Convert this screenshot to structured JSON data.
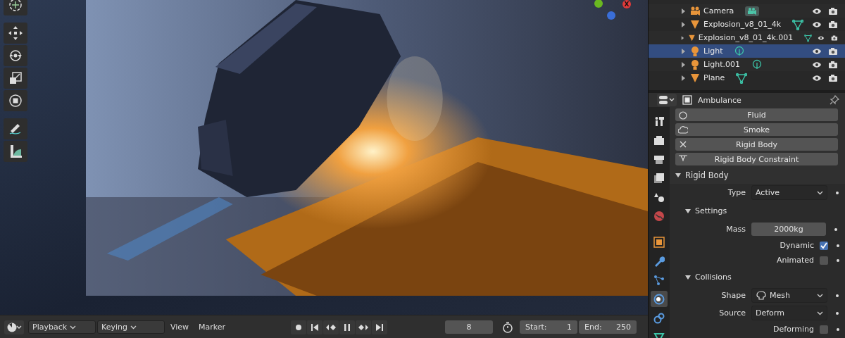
{
  "viewport": {
    "gizmo_x": "X",
    "tools": [
      {
        "kind": "cursor"
      },
      {
        "kind": "move"
      },
      {
        "kind": "rotate"
      },
      {
        "kind": "scale"
      },
      {
        "kind": "transform"
      },
      {
        "kind": "annotate"
      },
      {
        "kind": "measure"
      }
    ]
  },
  "timeline": {
    "menus": [
      {
        "label": "Playback",
        "dropdown": true
      },
      {
        "label": "Keying",
        "dropdown": true
      },
      {
        "label": "View",
        "dropdown": false
      },
      {
        "label": "Marker",
        "dropdown": false
      }
    ],
    "transport": [
      {
        "kind": "record"
      },
      {
        "kind": "jump-start"
      },
      {
        "kind": "prev-key"
      },
      {
        "kind": "pause"
      },
      {
        "kind": "next-key"
      },
      {
        "kind": "jump-end"
      }
    ],
    "current_frame": "8",
    "start_label": "Start:",
    "start": "1",
    "end_label": "End:",
    "end": "250"
  },
  "outliner": {
    "rows": [
      {
        "name": "Camera",
        "kind": "camera",
        "selected": false
      },
      {
        "name": "Explosion_v8_01_4k",
        "kind": "mesh",
        "selected": false
      },
      {
        "name": "Explosion_v8_01_4k.001",
        "kind": "mesh",
        "selected": false
      },
      {
        "name": "Light",
        "kind": "light",
        "selected": true
      },
      {
        "name": "Light.001",
        "kind": "light",
        "selected": false
      },
      {
        "name": "Plane",
        "kind": "mesh",
        "selected": false
      }
    ]
  },
  "properties": {
    "object_name": "Ambulance",
    "tabs": [
      {
        "kind": "tool",
        "selected": false
      },
      {
        "kind": "render",
        "selected": false
      },
      {
        "kind": "output",
        "selected": false
      },
      {
        "kind": "view-layer",
        "selected": false
      },
      {
        "kind": "scene",
        "selected": false
      },
      {
        "kind": "world",
        "selected": false
      },
      {
        "kind": "object",
        "selected": false
      },
      {
        "kind": "modifier",
        "selected": false
      },
      {
        "kind": "particles",
        "selected": false
      },
      {
        "kind": "physics",
        "selected": true
      },
      {
        "kind": "constraint",
        "selected": false
      },
      {
        "kind": "data",
        "selected": false
      }
    ],
    "physics_buttons": [
      {
        "label": "Fluid",
        "kind": "fluid"
      },
      {
        "label": "Smoke",
        "kind": "smoke"
      },
      {
        "label": "Rigid Body",
        "kind": "remove"
      },
      {
        "label": "Rigid Body Constraint",
        "kind": "constraint"
      }
    ],
    "panel": {
      "title": "Rigid Body",
      "expanded": true,
      "rows": [
        {
          "kind": "dropdown",
          "label": "Type",
          "value": "Active"
        },
        {
          "kind": "subpanel",
          "title": "Settings",
          "expanded": true
        },
        {
          "kind": "number",
          "label": "Mass",
          "value": "2000kg"
        },
        {
          "kind": "checkbox",
          "label": "Dynamic",
          "checked": true
        },
        {
          "kind": "checkbox",
          "label": "Animated",
          "checked": false
        },
        {
          "kind": "subpanel",
          "title": "Collisions",
          "expanded": true
        },
        {
          "kind": "icon-dropdown",
          "label": "Shape",
          "value": "Mesh"
        },
        {
          "kind": "dropdown",
          "label": "Source",
          "value": "Deform"
        },
        {
          "kind": "checkbox",
          "label": "Deforming",
          "checked": false
        }
      ]
    }
  }
}
